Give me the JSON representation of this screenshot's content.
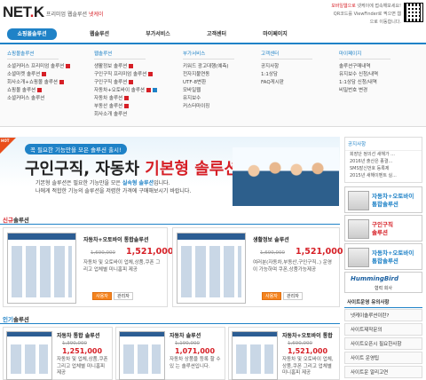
{
  "header": {
    "logo_main": "NET",
    "logo_dot": ".",
    "logo_k": "K",
    "tagline": "프리미엄 웹솔루션",
    "tagline_brand": "넷케이",
    "qr_text_1": "모바일웹으로",
    "qr_text_2": "넷케이에 접속해보세요!",
    "qr_text_3": "QR코드를 ViewFinder로 찍으면 웹 으로 이동합니다."
  },
  "gnb": [
    "쇼핑몰솔루션",
    "웹솔루션",
    "부가서비스",
    "고객센터",
    "마이페이지"
  ],
  "mega": [
    {
      "head": "쇼핑몰솔루션",
      "items": [
        "소셜커머스 프리미엄 솔루션",
        "소셜마켓 솔루션",
        "회사소개+쇼핑몰 솔루션",
        "쇼핑몰 솔루션",
        "소셜커머스 솔루션"
      ]
    },
    {
      "head": "웹솔루션",
      "items": [
        "생활정보 솔루션",
        "구인구직 프리미엄 솔루션",
        "구인구직 솔루션",
        "자동차+오토바이 솔루션",
        "자동차 솔루션",
        "부동산 솔루션",
        "회사소개 솔루션"
      ]
    },
    {
      "head": "부가서비스",
      "items": [
        "키워드 광고대행(예측)",
        "전자지불연동",
        "UTF-8변환",
        "모바일웹",
        "유지보수",
        "커스터마이징"
      ]
    },
    {
      "head": "고객센터",
      "items": [
        "공지사항",
        "1:1상담",
        "FAQ게시판"
      ]
    },
    {
      "head": "마이페이지",
      "items": [
        "솔루션구매내역",
        "유지보수 신청/내역",
        "1:1상담 신청/내역",
        "비밀번호 변경"
      ]
    }
  ],
  "banner": {
    "small": "꼭 필요한 기능만을 모은 솔루션 출시!",
    "title_a": "구인구직, 자동차 ",
    "title_b": "기본형 솔루션",
    "desc_1": "기본형 솔루션은 필요한 기능만을 모은 ",
    "desc_bold": "실속형 솔루션",
    "desc_1b": "입니다.",
    "desc_2": "나에게 적합한 기능의 솔루션을 저렴한 가격에 구매해보시기 바랍니다.",
    "hot": "HOT"
  },
  "side": {
    "notice_title": "공지사항",
    "notice_items": [
      "회장단 정의선 새해가 ...",
      "2016년 출산은 종결...",
      "SMS발신번호 등록제",
      "2015년 새해이벤트 실..."
    ],
    "cards": [
      {
        "title_1": "자동차+오토바이",
        "title_2": "통합솔루션",
        "accent": "#1f82c7"
      },
      {
        "title_1": "구인구직",
        "title_2": "솔루션",
        "accent": "#d61f26"
      },
      {
        "title_1": "자동차+오토바이",
        "title_2": "통합솔루션",
        "accent": "#1f82c7"
      }
    ],
    "partner": "HummingBird",
    "partner_caption": "협력 회사",
    "links_title": "사이트운영 유의사항",
    "links": [
      "넷케이솔루션이란?",
      "사이트제작문의",
      "사이트오픈시 필요한사항",
      "사이트 운영팁",
      "사이트운 알리고연"
    ]
  },
  "new_section": {
    "title_a": "신규",
    "title_b": "솔루션",
    "products": [
      {
        "name": "자동차+오토바이 통합솔루션",
        "old": "1,690,000",
        "price": "1,521,000",
        "desc": "자동차 및 오토바이 업체,상품,쿠폰 그리고 업체별 미니홈피 제공",
        "btn_buy": "사용자",
        "btn_admin": "관리자"
      },
      {
        "name": "생활정보 솔루션",
        "old": "1,690,000",
        "price": "1,521,000",
        "desc": "여러분(자동차,부동산,구인구직..) 운영이 가능하며 쿠폰,상품가능제공",
        "btn_buy": "사용자",
        "btn_admin": "관리자"
      }
    ]
  },
  "popular_section": {
    "title_a": "인기",
    "title_b": "솔루션",
    "products": [
      {
        "name": "자동차 통합 솔루션",
        "old": "1,390,000",
        "price": "1,251,000",
        "desc": "자동차 및 업체,상품,쿠폰 그리고 업체별 미니홈피 제공"
      },
      {
        "name": "자동차 솔루션",
        "old": "1,190,000",
        "price": "1,071,000",
        "desc": "자동차 상품을 등록 할 수 있 는 솔루션입니다."
      },
      {
        "name": "자동차+오토바이 통합",
        "old": "1,690,000",
        "price": "1,521,000",
        "desc": "자동차 및 오토바이 업체,상품,쿠폰 그리고 업체별 미니홈피 제공"
      }
    ]
  },
  "colors": {
    "brand_red": "#d61f26",
    "brand_blue": "#1f82c7",
    "hot": "#e94e1b",
    "buy_button": "#f5841f"
  }
}
